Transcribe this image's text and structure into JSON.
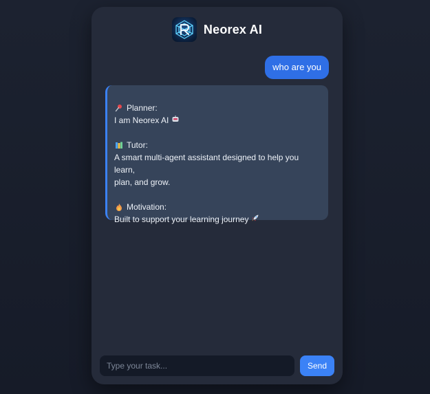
{
  "header": {
    "title": "Neorex AI",
    "logo_icon": "neorex-logo"
  },
  "messages": {
    "user": {
      "text": "who are you"
    },
    "bot": {
      "sections": [
        {
          "icon": "pushpin-icon",
          "heading": "Planner:",
          "lines": [
            "I am Neorex AI"
          ],
          "trailing_icon": "robot-icon"
        },
        {
          "icon": "books-icon",
          "heading": "Tutor:",
          "lines": [
            "A smart multi-agent assistant designed to help you learn,",
            "plan, and grow."
          ]
        },
        {
          "icon": "fire-icon",
          "heading": "Motivation:",
          "lines": [
            "Built to support your learning journey"
          ],
          "trailing_icon": "rocket-icon"
        }
      ]
    }
  },
  "input": {
    "placeholder": "Type your task...",
    "value": ""
  },
  "send_button": {
    "label": "Send"
  },
  "colors": {
    "background": "#1a1f2c",
    "card": "#252b3a",
    "user_bubble": "#2f6fe6",
    "bot_bubble": "#36445a",
    "accent": "#3b82f6",
    "input_bg": "#141a27"
  }
}
